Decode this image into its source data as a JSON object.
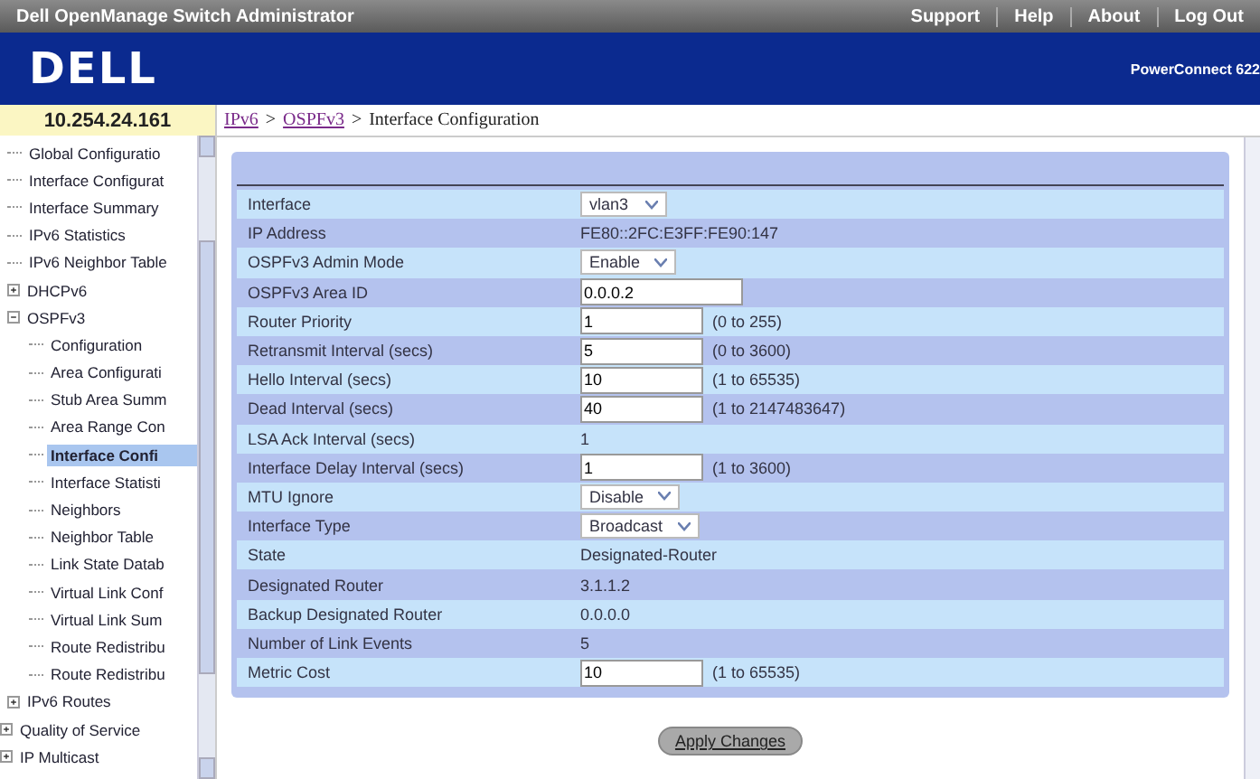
{
  "app_bar": {
    "title": "Dell OpenManage Switch Administrator",
    "links": [
      "Support",
      "Help",
      "About",
      "Log Out"
    ]
  },
  "brand_bar": {
    "logo": "DELL",
    "model": "PowerConnect 622"
  },
  "address": "10.254.24.161",
  "breadcrumb": [
    {
      "label": "IPv6",
      "kind": "link"
    },
    {
      "label": ">",
      "kind": "separator"
    },
    {
      "label": "OSPFv3",
      "kind": "link"
    },
    {
      "label": ">",
      "kind": "separator"
    },
    {
      "label": "Interface Configuration",
      "kind": "current"
    }
  ],
  "sidebar": {
    "items": [
      {
        "kind": "continued",
        "children": [
          {
            "label": "Global Configuratio",
            "kind": "leaf",
            "selected": false
          },
          {
            "label": "Interface Configurat",
            "kind": "leaf",
            "selected": false
          },
          {
            "label": "Interface Summary",
            "kind": "leaf",
            "selected": false
          },
          {
            "label": "IPv6 Statistics",
            "kind": "leaf",
            "selected": false
          },
          {
            "label": "IPv6 Neighbor Table",
            "kind": "leaf",
            "selected": false
          },
          {
            "label": "DHCPv6",
            "kind": "folder",
            "expanded": false
          },
          {
            "label": "OSPFv3",
            "kind": "folder",
            "expanded": true,
            "children": [
              {
                "label": "Configuration",
                "kind": "leaf",
                "selected": false
              },
              {
                "label": "Area Configurati",
                "kind": "leaf",
                "selected": false
              },
              {
                "label": "Stub Area Summ",
                "kind": "leaf",
                "selected": false
              },
              {
                "label": "Area Range Con",
                "kind": "leaf",
                "selected": false
              },
              {
                "label": "Interface Confi",
                "kind": "leaf",
                "selected": true
              },
              {
                "label": "Interface Statisti",
                "kind": "leaf",
                "selected": false
              },
              {
                "label": "Neighbors",
                "kind": "leaf",
                "selected": false
              },
              {
                "label": "Neighbor Table",
                "kind": "leaf",
                "selected": false
              },
              {
                "label": "Link State Datab",
                "kind": "leaf",
                "selected": false
              },
              {
                "label": "Virtual Link Conf",
                "kind": "leaf",
                "selected": false
              },
              {
                "label": "Virtual Link Sum",
                "kind": "leaf",
                "selected": false
              },
              {
                "label": "Route Redistribu",
                "kind": "leaf",
                "selected": false
              },
              {
                "label": "Route Redistribu",
                "kind": "leaf",
                "selected": false
              }
            ]
          },
          {
            "label": "IPv6 Routes",
            "kind": "folder",
            "expanded": false
          }
        ]
      },
      {
        "label": "Quality of Service",
        "kind": "folder",
        "expanded": false
      },
      {
        "label": "IP Multicast",
        "kind": "folder",
        "expanded": false
      }
    ]
  },
  "form": {
    "rows": [
      {
        "label": "Interface",
        "kind": "select",
        "value": "vlan3"
      },
      {
        "label": "IP Address",
        "kind": "text",
        "value": "FE80::2FC:E3FF:FE90:147"
      },
      {
        "label": "OSPFv3 Admin Mode",
        "kind": "select",
        "value": "Enable"
      },
      {
        "label": "OSPFv3 Area ID",
        "kind": "input",
        "value": "0.0.0.2"
      },
      {
        "label": "Router Priority",
        "kind": "input",
        "value": "1",
        "hint": "(0 to 255)"
      },
      {
        "label": "Retransmit Interval (secs)",
        "kind": "input",
        "value": "5",
        "hint": "(0 to 3600)"
      },
      {
        "label": "Hello Interval (secs)",
        "kind": "input",
        "value": "10",
        "hint": "(1 to 65535)"
      },
      {
        "label": "Dead Interval (secs)",
        "kind": "input",
        "value": "40",
        "hint": "(1 to 2147483647)"
      },
      {
        "label": "LSA Ack Interval (secs)",
        "kind": "text",
        "value": "1"
      },
      {
        "label": "Interface Delay Interval (secs)",
        "kind": "input",
        "value": "1",
        "hint": "(1 to 3600)"
      },
      {
        "label": "MTU Ignore",
        "kind": "select",
        "value": "Disable"
      },
      {
        "label": "Interface Type",
        "kind": "select",
        "value": "Broadcast"
      },
      {
        "label": "State",
        "kind": "text",
        "value": "Designated-Router"
      },
      {
        "label": "Designated Router",
        "kind": "text",
        "value": "3.1.1.2"
      },
      {
        "label": "Backup Designated Router",
        "kind": "text",
        "value": "0.0.0.0"
      },
      {
        "label": "Number of Link Events",
        "kind": "text",
        "value": "5"
      },
      {
        "label": "Metric Cost",
        "kind": "input",
        "value": "10",
        "hint": "(1 to 65535)"
      }
    ]
  },
  "apply_button": "Apply Changes"
}
